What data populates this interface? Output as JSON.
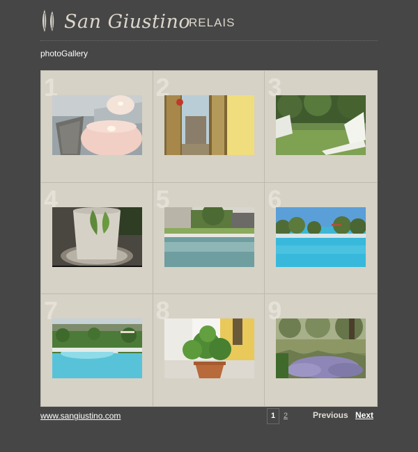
{
  "header": {
    "logo_script": "San Giustino",
    "logo_word": "RELAIS"
  },
  "gallery": {
    "title": "photoGallery",
    "items": [
      {
        "number": "1",
        "photo": "candles"
      },
      {
        "number": "2",
        "photo": "mirror"
      },
      {
        "number": "3",
        "photo": "lounge-chairs"
      },
      {
        "number": "4",
        "photo": "stone-urn"
      },
      {
        "number": "5",
        "photo": "pool-house"
      },
      {
        "number": "6",
        "photo": "pool-olives"
      },
      {
        "number": "7",
        "photo": "pool-garden"
      },
      {
        "number": "8",
        "photo": "potted-tree"
      },
      {
        "number": "9",
        "photo": "lavender-olives"
      }
    ]
  },
  "footer": {
    "site_link": "www.sangiustino.com",
    "pages": [
      "1",
      "2"
    ],
    "current_page": "1",
    "previous_label": "Previous",
    "next_label": "Next"
  },
  "colors": {
    "background": "#464646",
    "gallery_panel": "#d6d2c6",
    "text": "#ffffff"
  }
}
